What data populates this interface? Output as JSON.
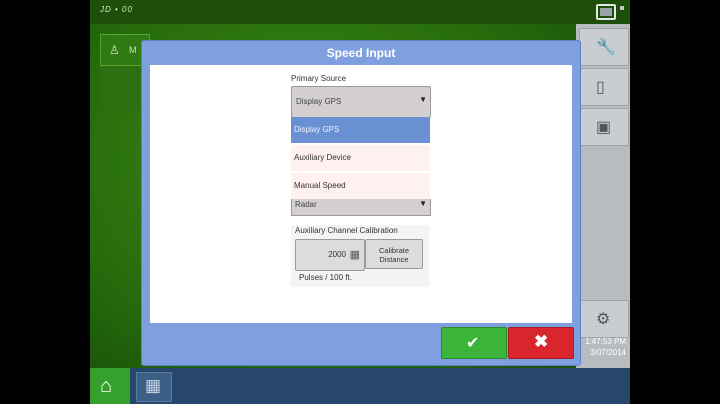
{
  "topbar": {
    "logo_text": "JD • 00",
    "window_icon": "window-icon"
  },
  "left_tile": {
    "icon": "operator-icon",
    "label": "M"
  },
  "right_panel": {
    "icons": [
      "wrench-icon",
      "bottle-icon",
      "window-icon",
      "tractor-icon"
    ],
    "time": "1:47:53 PM",
    "date": "3/07/2014"
  },
  "bottom_bar": {
    "home_icon": "home-icon",
    "grid_icon": "grid-icon"
  },
  "dialog": {
    "title": "Speed Input",
    "primary_source": {
      "label": "Primary Source",
      "selected": "Display GPS",
      "options": [
        "Display GPS",
        "Auxiliary Device",
        "Manual Speed"
      ]
    },
    "secondary_source": {
      "selected": "Radar"
    },
    "aux_calibration": {
      "label": "Auxiliary Channel Calibration",
      "value": "2000",
      "calibrate_label_line1": "Calibrate",
      "calibrate_label_line2": "Distance",
      "unit": "Pulses / 100 ft."
    },
    "ok_icon": "check-icon",
    "cancel_icon": "close-icon"
  },
  "colors": {
    "dialog_frame": "#7f9fde",
    "selected_option": "#6890d2",
    "ok_green": "#3ab53a",
    "cancel_red": "#d8262c",
    "background_green": "#2f7a12"
  }
}
